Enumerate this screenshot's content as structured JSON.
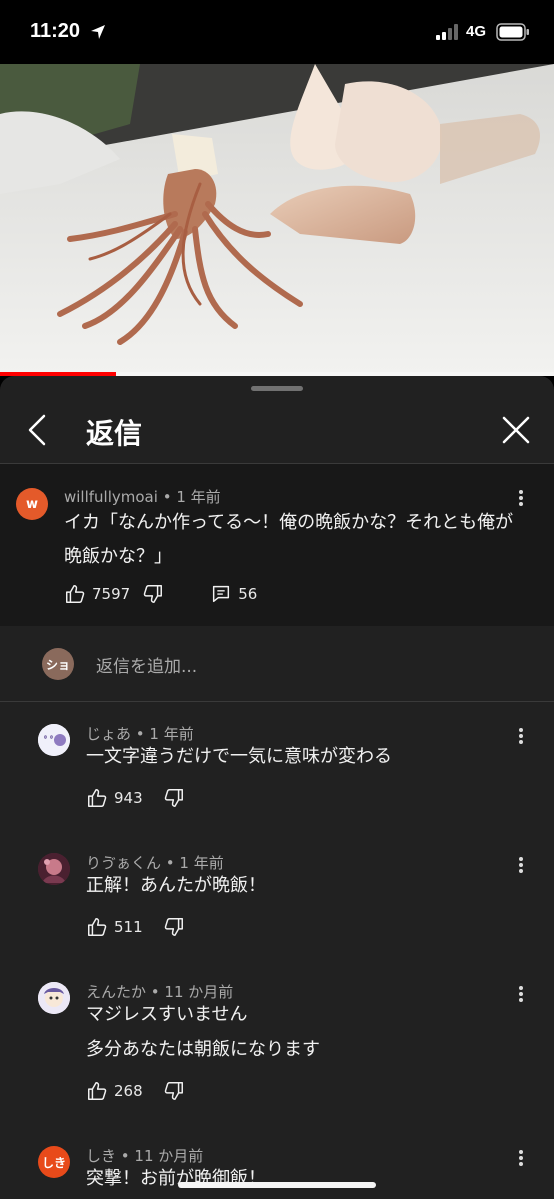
{
  "status_bar": {
    "time": "11:20",
    "network": "4G"
  },
  "video": {
    "progress_percent": 21
  },
  "sheet": {
    "title": "返信"
  },
  "parent_comment": {
    "avatar_letter": "w",
    "author": "willfullymoai",
    "time": "1 年前",
    "text_line1": "イカ「なんか作ってる〜！俺の晩飯かな？それとも俺が",
    "text_line2": "晩飯かな？」",
    "likes": "7597",
    "replies": "56"
  },
  "add_reply": {
    "avatar_text": "ショ",
    "placeholder": "返信を追加..."
  },
  "replies": [
    {
      "author": "じょあ",
      "time": "1 年前",
      "text": "一文字違うだけで一気に意味が変わる",
      "likes": "943"
    },
    {
      "author": "りゔぁくん",
      "time": "1 年前",
      "text": "正解！あんたが晩飯！",
      "likes": "511"
    },
    {
      "author": "えんたか",
      "time": "11 か月前",
      "text_line1": "マジレスすいません",
      "text_line2": "多分あなたは朝飯になります",
      "likes": "268"
    },
    {
      "avatar_text": "しき",
      "author": "しき",
      "time": "11 か月前",
      "text": "突撃！お前が晩御飯！"
    }
  ],
  "separator": " • ",
  "colors": {
    "accent_red": "#ff0000",
    "sheet_bg": "#212121",
    "parent_bg": "#181818"
  }
}
